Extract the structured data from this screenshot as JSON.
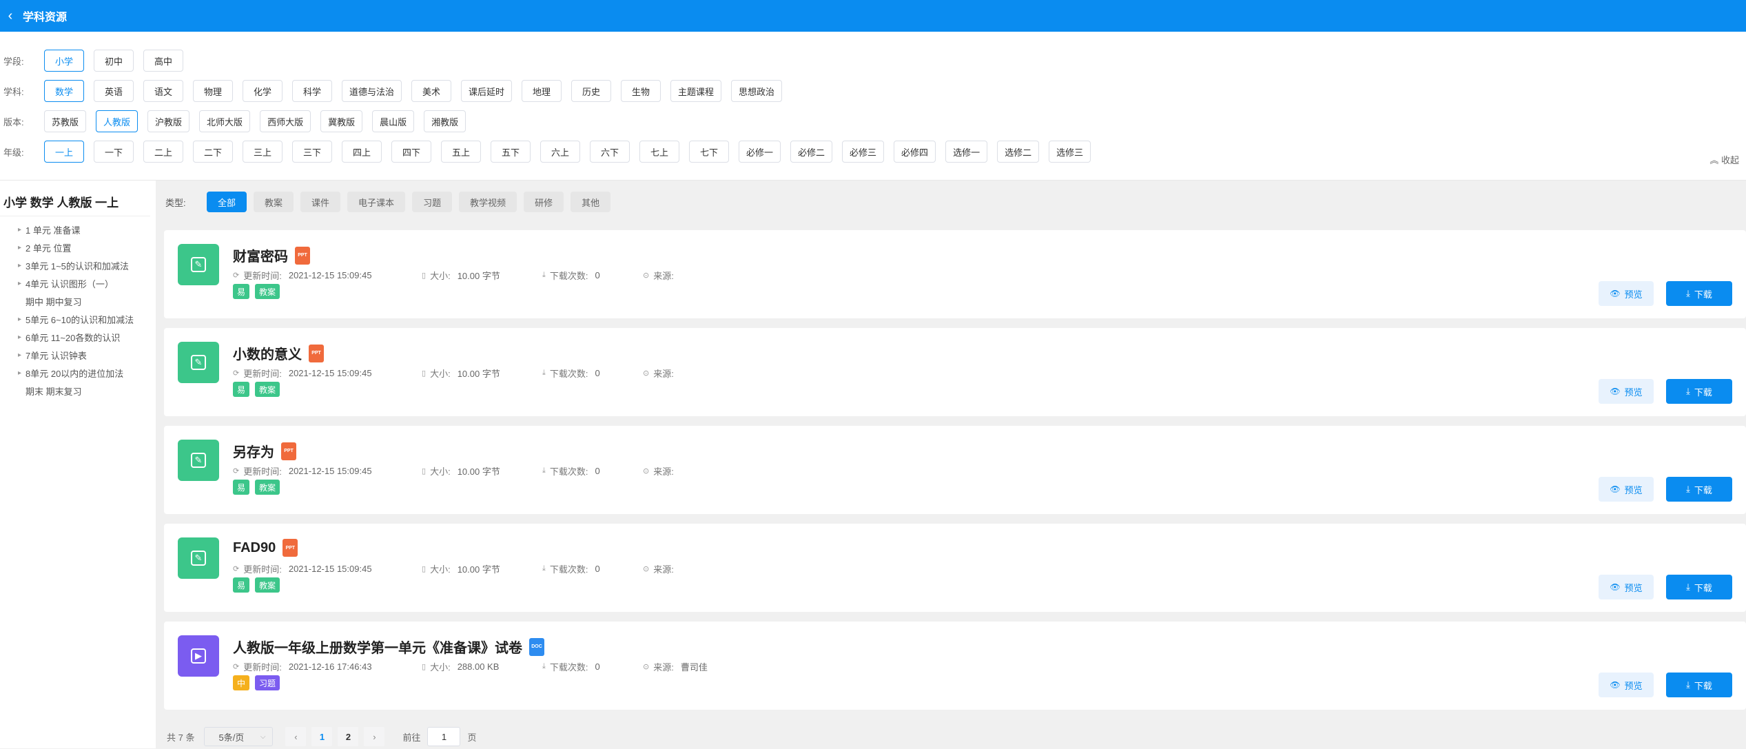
{
  "header": {
    "back_icon": "chevron-left-icon",
    "title": "学科资源"
  },
  "filters": {
    "stage": {
      "label": "学段:",
      "options": [
        "小学",
        "初中",
        "高中"
      ],
      "selected": "小学"
    },
    "subject": {
      "label": "学科:",
      "options": [
        "数学",
        "英语",
        "语文",
        "物理",
        "化学",
        "科学",
        "道德与法治",
        "美术",
        "课后延时",
        "地理",
        "历史",
        "生物",
        "主题课程",
        "思想政治"
      ],
      "selected": "数学"
    },
    "edition": {
      "label": "版本:",
      "options": [
        "苏教版",
        "人教版",
        "沪教版",
        "北师大版",
        "西师大版",
        "冀教版",
        "晨山版",
        "湘教版"
      ],
      "selected": "人教版"
    },
    "grade": {
      "label": "年级:",
      "options": [
        "一上",
        "一下",
        "二上",
        "二下",
        "三上",
        "三下",
        "四上",
        "四下",
        "五上",
        "五下",
        "六上",
        "六下",
        "七上",
        "七下",
        "必修一",
        "必修二",
        "必修三",
        "必修四",
        "选修一",
        "选修二",
        "选修三"
      ],
      "selected": "一上"
    },
    "collapse_label": "收起"
  },
  "sidebar": {
    "title": "小学 数学 人教版 一上",
    "items": [
      {
        "label": "1 单元 准备课",
        "expandable": true
      },
      {
        "label": "2 单元 位置",
        "expandable": true
      },
      {
        "label": "3单元 1~5的认识和加减法",
        "expandable": true
      },
      {
        "label": "4单元 认识图形（一）",
        "expandable": true
      },
      {
        "label": "期中 期中复习",
        "expandable": false
      },
      {
        "label": "5单元 6~10的认识和加减法",
        "expandable": true
      },
      {
        "label": "6单元 11~20各数的认识",
        "expandable": true
      },
      {
        "label": "7单元 认识钟表",
        "expandable": true
      },
      {
        "label": "8单元 20以内的进位加法",
        "expandable": true
      },
      {
        "label": "期末 期末复习",
        "expandable": false
      }
    ]
  },
  "types": {
    "label": "类型:",
    "options": [
      "全部",
      "教案",
      "课件",
      "电子课本",
      "习题",
      "教学视频",
      "研修",
      "其他"
    ],
    "selected": "全部"
  },
  "meta_labels": {
    "time": "更新时间:",
    "size": "大小:",
    "downloads": "下载次数:",
    "source": "来源:"
  },
  "buttons": {
    "preview": "预览",
    "download": "下载"
  },
  "resources": [
    {
      "title": "财富密码",
      "file_type": "PPT",
      "icon_color": "#3cc68a",
      "updated": "2021-12-15 15:09:45",
      "size": "10.00 字节",
      "downloads": "0",
      "source": "",
      "tags": [
        {
          "text": "易",
          "color": "green"
        },
        {
          "text": "教案",
          "color": "green"
        }
      ]
    },
    {
      "title": "小数的意义",
      "file_type": "PPT",
      "icon_color": "#3cc68a",
      "updated": "2021-12-15 15:09:45",
      "size": "10.00 字节",
      "downloads": "0",
      "source": "",
      "tags": [
        {
          "text": "易",
          "color": "green"
        },
        {
          "text": "教案",
          "color": "green"
        }
      ]
    },
    {
      "title": "另存为",
      "file_type": "PPT",
      "icon_color": "#3cc68a",
      "updated": "2021-12-15 15:09:45",
      "size": "10.00 字节",
      "downloads": "0",
      "source": "",
      "tags": [
        {
          "text": "易",
          "color": "green"
        },
        {
          "text": "教案",
          "color": "green"
        }
      ]
    },
    {
      "title": "FAD90",
      "file_type": "PPT",
      "icon_color": "#3cc68a",
      "updated": "2021-12-15 15:09:45",
      "size": "10.00 字节",
      "downloads": "0",
      "source": "",
      "tags": [
        {
          "text": "易",
          "color": "green"
        },
        {
          "text": "教案",
          "color": "green"
        }
      ]
    },
    {
      "title": "人教版一年级上册数学第一单元《准备课》试卷",
      "file_type": "DOC",
      "icon_color": "#7b5cf0",
      "updated": "2021-12-16 17:46:43",
      "size": "288.00 KB",
      "downloads": "0",
      "source": "曹司佳",
      "tags": [
        {
          "text": "中",
          "color": "orange"
        },
        {
          "text": "习题",
          "color": "purple"
        }
      ]
    }
  ],
  "pagination": {
    "total_label": "共 7 条",
    "page_size": "5条/页",
    "pages": [
      "1",
      "2"
    ],
    "current": "1",
    "goto_label": "前往",
    "goto_value": "1",
    "page_suffix": "页"
  }
}
